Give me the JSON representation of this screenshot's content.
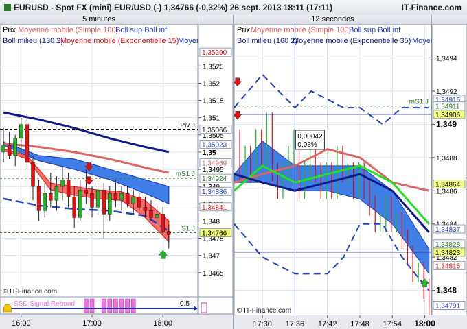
{
  "window": {
    "title": "EURUSD - Spot FX (mini) EUR/USD (-)  1,34766 (-0,32%)  26 sept. 2013 18:11 (17:11)",
    "brand": "IT-Finance.com"
  },
  "colors": {
    "bg": "#ffffff",
    "grid": "#c8d3e6",
    "price_up": "#22b422",
    "price_down": "#e01010",
    "sma100": "#e06464",
    "boll": "#2040c8",
    "ema15": "#e01010",
    "long_ma": "#0a1a8c",
    "ema35": "#22e022",
    "ribbon_blue": "#3f7fe6",
    "ribbon_red": "#ff5a5a"
  },
  "icons": {
    "down_arrow": "arrow-down-icon",
    "up_arrow": "arrow-up-icon",
    "bell": "bell-icon"
  },
  "chart_data": [
    {
      "type": "candlestick",
      "title": "5 minutes",
      "legend": [
        "Prix",
        "Moyenne mobile (Simple 100)",
        "Boll sup Boll inf",
        "Boll milieu (130 2)",
        "Moyenne mobile (Exponentielle 15)",
        "Moyen"
      ],
      "ylim": [
        1.3458,
        1.3537
      ],
      "y_ticks": [
        1.3465,
        1.347,
        1.3475,
        1.348,
        1.3485,
        1.349,
        1.3495,
        1.35,
        1.3505,
        1.351,
        1.3515,
        1.352,
        1.3525
      ],
      "y_tick_labels": [
        "1,3465",
        "1,347",
        "1,3475",
        "1,348",
        "1,3485",
        "1,349",
        "1,3495",
        "1,35",
        "1,3505",
        "1,351",
        "1,3515",
        "1,352",
        "1,3525"
      ],
      "x_ticks": [
        "16:00",
        "17:00",
        "18:00"
      ],
      "x_tick_pos": [
        3,
        15,
        27
      ],
      "n_bars": 29,
      "candles": [
        {
          "o": 1.35,
          "h": 1.3507,
          "l": 1.3497,
          "c": 1.3502
        },
        {
          "o": 1.3502,
          "h": 1.3506,
          "l": 1.3498,
          "c": 1.3499
        },
        {
          "o": 1.3499,
          "h": 1.3505,
          "l": 1.3496,
          "c": 1.3504
        },
        {
          "o": 1.3504,
          "h": 1.351,
          "l": 1.35,
          "c": 1.3508
        },
        {
          "o": 1.3508,
          "h": 1.3511,
          "l": 1.3495,
          "c": 1.3497
        },
        {
          "o": 1.3497,
          "h": 1.3499,
          "l": 1.3486,
          "c": 1.349
        },
        {
          "o": 1.349,
          "h": 1.3492,
          "l": 1.348,
          "c": 1.3483
        },
        {
          "o": 1.3483,
          "h": 1.3491,
          "l": 1.3481,
          "c": 1.3488
        },
        {
          "o": 1.3488,
          "h": 1.3494,
          "l": 1.3484,
          "c": 1.3486
        },
        {
          "o": 1.3486,
          "h": 1.3493,
          "l": 1.3483,
          "c": 1.349
        },
        {
          "o": 1.349,
          "h": 1.3496,
          "l": 1.3486,
          "c": 1.3492
        },
        {
          "o": 1.3492,
          "h": 1.3494,
          "l": 1.3484,
          "c": 1.3487
        },
        {
          "o": 1.3487,
          "h": 1.349,
          "l": 1.3478,
          "c": 1.3481
        },
        {
          "o": 1.3481,
          "h": 1.3492,
          "l": 1.348,
          "c": 1.3489
        },
        {
          "o": 1.3489,
          "h": 1.3495,
          "l": 1.3485,
          "c": 1.3488
        },
        {
          "o": 1.3488,
          "h": 1.349,
          "l": 1.3481,
          "c": 1.3484
        },
        {
          "o": 1.3484,
          "h": 1.3491,
          "l": 1.3482,
          "c": 1.3489
        },
        {
          "o": 1.3489,
          "h": 1.3491,
          "l": 1.3475,
          "c": 1.3482
        },
        {
          "o": 1.3482,
          "h": 1.349,
          "l": 1.348,
          "c": 1.3488
        },
        {
          "o": 1.3488,
          "h": 1.3492,
          "l": 1.3484,
          "c": 1.3486
        },
        {
          "o": 1.3486,
          "h": 1.349,
          "l": 1.3483,
          "c": 1.3488
        },
        {
          "o": 1.3488,
          "h": 1.349,
          "l": 1.3484,
          "c": 1.3485
        },
        {
          "o": 1.3485,
          "h": 1.3489,
          "l": 1.3482,
          "c": 1.3487
        },
        {
          "o": 1.3487,
          "h": 1.3488,
          "l": 1.3483,
          "c": 1.3484
        },
        {
          "o": 1.3484,
          "h": 1.3487,
          "l": 1.3481,
          "c": 1.3483
        },
        {
          "o": 1.3483,
          "h": 1.3486,
          "l": 1.348,
          "c": 1.3481
        },
        {
          "o": 1.3481,
          "h": 1.3485,
          "l": 1.3479,
          "c": 1.3482
        },
        {
          "o": 1.3482,
          "h": 1.3484,
          "l": 1.3476,
          "c": 1.3477
        },
        {
          "o": 1.3477,
          "h": 1.3479,
          "l": 1.3472,
          "c": 1.3476
        }
      ],
      "series": [
        {
          "name": "Moyenne mobile (Simple 100)",
          "kind": "line",
          "x": [
            0,
            6,
            12,
            18,
            24,
            28
          ],
          "y": [
            1.35025,
            1.35015,
            1.35,
            1.3498,
            1.34955,
            1.3494
          ]
        },
        {
          "name": "Moyen",
          "kind": "line",
          "x": [
            0,
            6,
            12,
            18,
            24,
            28
          ],
          "y": [
            1.35115,
            1.35095,
            1.3507,
            1.3504,
            1.35015,
            1.35
          ]
        },
        {
          "name": "Boll sup Boll inf",
          "kind": "band",
          "x": [
            0,
            6,
            12,
            18,
            24,
            28
          ],
          "upper": [
            1.3503,
            1.3499,
            1.3498,
            1.3495,
            1.3492,
            1.349
          ],
          "lower": [
            1.3502,
            1.34975,
            1.3495,
            1.3492,
            1.3488,
            1.3485
          ]
        },
        {
          "name": "Boll milieu (130 2)",
          "kind": "dashed",
          "x": [
            0,
            6,
            12,
            18,
            24,
            28
          ],
          "y": [
            1.34865,
            1.34845,
            1.34835,
            1.3483,
            1.34815,
            1.3477
          ]
        },
        {
          "name": "Moyenne mobile (Exponentielle 15)",
          "kind": "band",
          "x": [
            0,
            4,
            8,
            12,
            16,
            20,
            24,
            28
          ],
          "upper": [
            1.3501,
            1.3499,
            1.3491,
            1.349,
            1.3489,
            1.34885,
            1.3486,
            1.348
          ],
          "lower": [
            1.35005,
            1.3498,
            1.3489,
            1.34875,
            1.34865,
            1.3486,
            1.3481,
            1.3474
          ]
        }
      ],
      "hlines": [
        {
          "label": "Piv J",
          "y": 1.35066,
          "style": "pivot"
        },
        {
          "label": "mS1 J",
          "y": 1.34924,
          "style": "support"
        },
        {
          "label": "S1 J",
          "y": 1.34766,
          "style": "support"
        }
      ],
      "price_tags": [
        {
          "y": 1.3529,
          "text": "1,35290",
          "color": "#e01010"
        },
        {
          "y": 1.35066,
          "text": "1,35066",
          "color": "#111111"
        },
        {
          "y": 1.35023,
          "text": "1,35023",
          "color": "#2040c8"
        },
        {
          "y": 1.34969,
          "text": "1,34969",
          "color": "#e06464"
        },
        {
          "y": 1.34924,
          "text": "1,34924",
          "color": "#2a7a2a"
        },
        {
          "y": 1.34886,
          "text": "1,34886",
          "color": "#2040c8"
        },
        {
          "y": 1.34841,
          "text": "1,34841",
          "color": "#e01010"
        },
        {
          "y": 1.34766,
          "text": "1,34766",
          "color": "#000000",
          "highlight": true
        }
      ],
      "signals": [
        {
          "bar": 14.5,
          "y": 1.34955,
          "dir": "down"
        },
        {
          "bar": 14.5,
          "y": 1.34915,
          "dir": "down"
        },
        {
          "bar": 27,
          "y": 1.34705,
          "dir": "up"
        }
      ],
      "copyright": "© IT-Finance.com",
      "indicator": {
        "label": "SSD Signal Rebond",
        "value": "0,5",
        "pulse_bars": [
          14,
          15,
          17,
          18,
          19,
          20,
          21,
          22
        ]
      }
    },
    {
      "type": "line",
      "title": "12 secondes",
      "legend": [
        "Prix",
        "Moyenne mobile (Simple 100)",
        "Boll sup Boll inf",
        "Boll milieu (160 2)",
        "Moyenne mobile (Exponentielle 35)",
        "Moyen"
      ],
      "ylim": [
        1.34785,
        1.3496
      ],
      "y_ticks": [
        1.348,
        1.3482,
        1.3484,
        1.3486,
        1.3488,
        1.349,
        1.3492,
        1.3494
      ],
      "y_tick_labels": [
        "1,348",
        "1,3482",
        "1,3484",
        "1,3486",
        "1,3488",
        "1,349",
        "1,3492",
        "1,3494"
      ],
      "x_range": [
        17.413,
        18.02
      ],
      "x_ticks": [
        17.5,
        17.6,
        17.7,
        17.8,
        17.9,
        18.0
      ],
      "x_tick_labels": [
        "17:30",
        "17:36",
        "17:42",
        "17:48",
        "17:54",
        "18:00"
      ],
      "price_x": [
        17.413,
        17.43,
        17.447,
        17.463,
        17.48,
        17.497,
        17.513,
        17.53,
        17.547,
        17.563,
        17.58,
        17.597,
        17.613,
        17.63,
        17.647,
        17.663,
        17.68,
        17.697,
        17.713,
        17.73,
        17.747,
        17.763,
        17.78,
        17.797,
        17.813,
        17.83,
        17.847,
        17.863,
        17.88,
        17.897,
        17.913,
        17.93,
        17.947,
        17.963,
        17.98,
        17.997,
        18.013
      ],
      "price": [
        1.3489,
        1.3487,
        1.3488,
        1.3487,
        1.3489,
        1.3488,
        1.349,
        1.3487,
        1.3486,
        1.3487,
        1.3488,
        1.3489,
        1.3486,
        1.3487,
        1.3488,
        1.3487,
        1.3486,
        1.3487,
        1.3486,
        1.3488,
        1.3487,
        1.3487,
        1.3486,
        1.3487,
        1.3486,
        1.3485,
        1.3484,
        1.3484,
        1.3485,
        1.3484,
        1.3484,
        1.3483,
        1.3482,
        1.3481,
        1.3481,
        1.348,
        1.3479
      ],
      "series": [
        {
          "name": "Boll sup",
          "kind": "dashed",
          "x": [
            17.413,
            17.5,
            17.55,
            17.6,
            17.65,
            17.75,
            17.8,
            17.87,
            17.93,
            18.013
          ],
          "y": [
            1.3491,
            1.3493,
            1.3492,
            1.3491,
            1.3492,
            1.3491,
            1.3491,
            1.349,
            1.3491,
            1.3491
          ]
        },
        {
          "name": "Boll inf",
          "kind": "dashed",
          "x": [
            17.413,
            17.5,
            17.6,
            17.7,
            17.75,
            17.8,
            17.87,
            17.93,
            17.97,
            18.013
          ],
          "y": [
            1.3484,
            1.3482,
            1.3481,
            1.3481,
            1.3482,
            1.3484,
            1.3484,
            1.3482,
            1.3481,
            1.348
          ]
        },
        {
          "name": "Moyenne mobile (Simple 100)",
          "kind": "line",
          "x": [
            17.413,
            17.5,
            17.6,
            17.7,
            17.8,
            17.9,
            18.013
          ],
          "y": [
            1.34865,
            1.3487,
            1.34875,
            1.34885,
            1.3488,
            1.34865,
            1.3486
          ]
        },
        {
          "name": "Boll milieu (160 2)",
          "kind": "line",
          "x": [
            17.413,
            17.5,
            17.6,
            17.7,
            17.8,
            17.9,
            18.013
          ],
          "y": [
            1.3487,
            1.34865,
            1.3486,
            1.34865,
            1.3487,
            1.3486,
            1.34835
          ]
        },
        {
          "name": "Moyenne mobile (Exponentielle 35)",
          "kind": "line",
          "x": [
            17.413,
            17.5,
            17.6,
            17.7,
            17.8,
            17.9,
            18.013
          ],
          "y": [
            1.3486,
            1.34875,
            1.34865,
            1.3487,
            1.34875,
            1.34865,
            1.3484
          ]
        },
        {
          "name": "Bollinger ribbon",
          "kind": "band",
          "x": [
            17.413,
            17.5,
            17.6,
            17.7,
            17.8,
            17.9,
            18.013
          ],
          "upper": [
            1.3487,
            1.3489,
            1.34875,
            1.34875,
            1.34875,
            1.3486,
            1.34825
          ],
          "lower": [
            1.34865,
            1.34865,
            1.3486,
            1.3486,
            1.34855,
            1.3484,
            1.3481
          ]
        }
      ],
      "hlines": [
        {
          "label": "mS1 J",
          "y": 1.34911,
          "style": "support"
        },
        {
          "label": "",
          "y": 1.34906,
          "style": "cursor"
        },
        {
          "label": "",
          "y": 1.34823,
          "style": "cursor"
        }
      ],
      "cursor_x": 17.6,
      "tooltip": [
        "0,00042",
        "0,03%"
      ],
      "price_tags": [
        {
          "y": 1.34915,
          "text": "1,34915",
          "color": "#2040c8"
        },
        {
          "y": 1.34911,
          "text": "1,34911",
          "color": "#2a7a2a"
        },
        {
          "y": 1.34906,
          "text": "1,34906",
          "color": "#000000",
          "highlight": true
        },
        {
          "y": 1.34864,
          "text": "1,34864",
          "color": "#000000",
          "highlight": true
        },
        {
          "y": 1.34837,
          "text": "1,34837",
          "color": "#2040c8"
        },
        {
          "y": 1.34828,
          "text": "1,34828",
          "color": "#2a7a2a"
        },
        {
          "y": 1.34823,
          "text": "1,34823",
          "color": "#000000",
          "highlight": true
        },
        {
          "y": 1.34815,
          "text": "1,34815",
          "color": "#e01010"
        },
        {
          "y": 1.34791,
          "text": "1,34791",
          "color": "#2040c8"
        }
      ],
      "signals": [
        {
          "x": 17.423,
          "y": 1.34925,
          "dir": "down"
        },
        {
          "x": 17.423,
          "y": 1.34905,
          "dir": "down"
        },
        {
          "x": 18.0,
          "y": 1.34805,
          "dir": "up"
        }
      ],
      "copyright": "© IT-Finance.com"
    }
  ]
}
